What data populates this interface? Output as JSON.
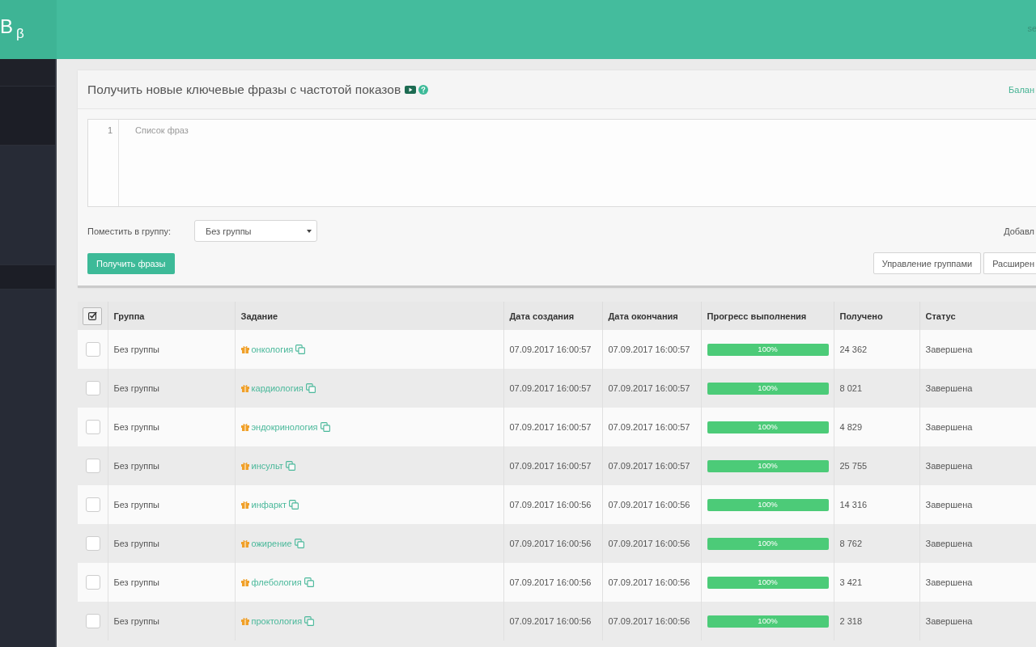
{
  "header": {
    "logo": "В",
    "logo_badge": "β",
    "account_text": "se"
  },
  "panel": {
    "title": "Получить новые ключевые фразы с частотой показов",
    "balance_link": "Балан",
    "editor": {
      "line_number": "1",
      "placeholder": "Список фраз"
    },
    "group_label": "Поместить в группу:",
    "group_select": {
      "value": "Без группы"
    },
    "add_text": "Добавл",
    "submit_button": "Получить фразы",
    "buttons": [
      "Управление группами",
      "Расширен"
    ]
  },
  "table": {
    "columns": [
      "Группа",
      "Задание",
      "Дата создания",
      "Дата окончания",
      "Прогресс выполнения",
      "Получено",
      "Статус"
    ],
    "rows": [
      {
        "checked": false,
        "group": "Без группы",
        "task": "онкология",
        "created": "07.09.2017 16:00:57",
        "finished": "07.09.2017 16:00:57",
        "progress": {
          "level": 1,
          "label": "100%"
        },
        "received": "24 362",
        "status": "Завершена"
      },
      {
        "checked": false,
        "group": "Без группы",
        "task": "кардиология",
        "created": "07.09.2017 16:00:57",
        "finished": "07.09.2017 16:00:57",
        "progress": {
          "level": 1,
          "label": "100%"
        },
        "received": "8 021",
        "status": "Завершена"
      },
      {
        "checked": false,
        "group": "Без группы",
        "task": "эндокринология",
        "created": "07.09.2017 16:00:57",
        "finished": "07.09.2017 16:00:57",
        "progress": {
          "level": 1,
          "label": "100%"
        },
        "received": "4 829",
        "status": "Завершена"
      },
      {
        "checked": false,
        "group": "Без группы",
        "task": "инсульт",
        "created": "07.09.2017 16:00:57",
        "finished": "07.09.2017 16:00:57",
        "progress": {
          "level": 1,
          "label": "100%"
        },
        "received": "25 755",
        "status": "Завершена"
      },
      {
        "checked": false,
        "group": "Без группы",
        "task": "инфаркт",
        "created": "07.09.2017 16:00:56",
        "finished": "07.09.2017 16:00:56",
        "progress": {
          "level": 1,
          "label": "100%"
        },
        "received": "14 316",
        "status": "Завершена"
      },
      {
        "checked": false,
        "group": "Без группы",
        "task": "ожирение",
        "created": "07.09.2017 16:00:56",
        "finished": "07.09.2017 16:00:56",
        "progress": {
          "level": 1,
          "label": "100%"
        },
        "received": "8 762",
        "status": "Завершена"
      },
      {
        "checked": false,
        "group": "Без группы",
        "task": "флебология",
        "created": "07.09.2017 16:00:56",
        "finished": "07.09.2017 16:00:56",
        "progress": {
          "level": 1,
          "label": "100%"
        },
        "received": "3 421",
        "status": "Завершена"
      },
      {
        "checked": false,
        "group": "Без группы",
        "task": "проктология",
        "created": "07.09.2017 16:00:56",
        "finished": "07.09.2017 16:00:56",
        "progress": {
          "level": 1,
          "label": "100%"
        },
        "received": "2 318",
        "status": "Завершена"
      }
    ]
  }
}
